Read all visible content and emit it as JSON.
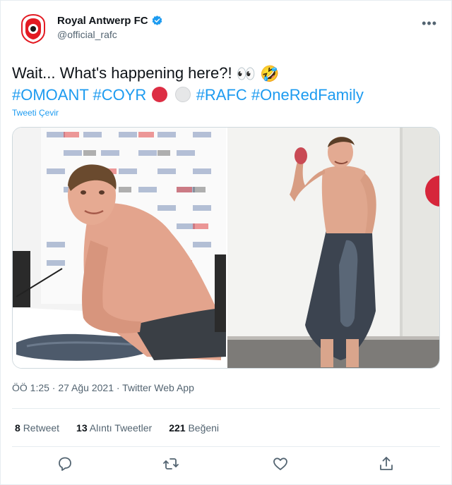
{
  "tweet": {
    "display_name": "Royal Antwerp FC",
    "handle": "@official_rafc",
    "more_icon": "more-horizontal-icon",
    "text_line1": "Wait... What's happening here?!",
    "emoji_eyes": "👀",
    "emoji_laugh": "🤣",
    "hashtags_part1": "#OMOANT #COYR",
    "hashtags_part2": "#RAFC #OneRedFamily",
    "translate_label": "Tweeti Çevir",
    "timestamp": "ÖÖ 1:25 · 27 Ağu 2021 · Twitter Web App"
  },
  "stats": {
    "retweets_count": "8",
    "retweets_label": "Retweet",
    "quotes_count": "13",
    "quotes_label": "Alıntı Tweetler",
    "likes_count": "221",
    "likes_label": "Beğeni"
  },
  "actions": {
    "icons": [
      "reply-icon",
      "retweet-icon",
      "like-icon",
      "share-icon"
    ]
  },
  "colors": {
    "accent": "#1d9bf0",
    "text": "#0f1419",
    "muted": "#536471",
    "brand_red": "#e31b23"
  }
}
